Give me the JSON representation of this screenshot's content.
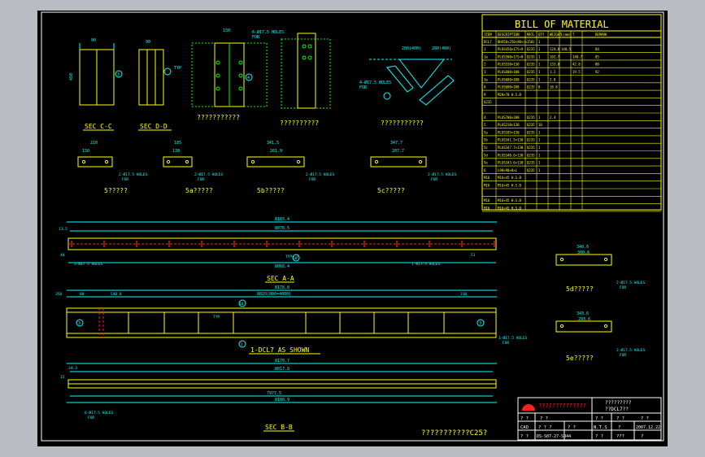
{
  "views": {
    "sec_cc": "SEC C-C",
    "sec_dd": "SEC D-D",
    "view_a": "???????????",
    "view_b": "??????????",
    "view_c": "???????????",
    "typ": "TYP",
    "dims_cc": [
      "90",
      "450"
    ],
    "dims_top": [
      "150",
      "280(400)",
      "280(400)",
      "390"
    ],
    "holes_top": "6-Ø17.5 HOLES",
    "for_top": "FOR",
    "holes_mid": "4-Ø17.5 HOLES",
    "for_mid": "FOR"
  },
  "plates": [
    {
      "label": "5?????",
      "dim_top": "210",
      "dims_in": [
        "80",
        "130",
        "80"
      ],
      "holes": "2-Ø17.5 HOLES",
      "for": "FOR"
    },
    {
      "label": "5a?????",
      "dim_top": "185",
      "dims_in": [
        "130"
      ],
      "holes": "2-Ø17.5 HOLES",
      "for": "FOR"
    },
    {
      "label": "5b?????",
      "dim_top": "341.5",
      "dims_in": [
        "261.9"
      ],
      "holes": "2-Ø17.5 HOLES",
      "for": "FOR"
    },
    {
      "label": "5c?????",
      "dim_top": "347.7",
      "dims_in": [
        "207.7"
      ],
      "holes": "2-Ø17.5 HOLES",
      "for": "FOR"
    },
    {
      "label": "5d?????",
      "dim_top": "340.6",
      "dims_in": [
        "300.6"
      ],
      "holes": "2-Ø17.5 HOLES",
      "for": "FOR"
    },
    {
      "label": "5e?????",
      "dim_top": "343.6",
      "dims_in": [
        "293.6"
      ],
      "holes": "2-Ø17.5 HOLES",
      "for": "FOR"
    }
  ],
  "sec_aa": {
    "title": "SEC A-A",
    "overall": "8183.4",
    "inner": "8078.5",
    "bottom_total": "8068.4",
    "typ": "TYP. 7",
    "left_holes": "3-Ø17.5 HOLES",
    "right_holes": "1-Ø17.5 HOLES",
    "small_dims": [
      "13.5",
      "40",
      "9"
    ],
    "dim_end": "51",
    "mark": "10"
  },
  "dcl7": {
    "title": "1-DCL7 AS SHOWN",
    "overall": "8178.8",
    "chain": "8810(800=4000)",
    "dims_left": [
      "350",
      "88",
      "540.8"
    ],
    "dim_right": "310",
    "holes": "1-Ø17.5 HOLES",
    "for": "FOR",
    "typ": "TYP",
    "marks": [
      "3",
      "1",
      "10"
    ]
  },
  "sec_bb": {
    "title": "SEC B-B",
    "overall": "8170.7",
    "inner": "8017.8",
    "bottom1": "7977.5",
    "bottom2": "8180.9",
    "holes": "6-Ø17.5 HOLES",
    "for": "FOR",
    "small_dims": [
      "34.3",
      "15"
    ],
    "mark": "10"
  },
  "bom": {
    "title": "BILL OF MATERIAL",
    "headers": [
      "ITEM",
      "DESCRIPTION",
      "MATL",
      "QTY",
      "WEIGHT",
      "L(mm)",
      "T",
      "REMARK"
    ],
    "rows": [
      [
        "DCL7",
        "BH450×250×90×(×150)",
        "",
        "1",
        "",
        "",
        "",
        ""
      ],
      [
        "1",
        "PLUS450×175×9",
        "Q235",
        "1",
        "124.8",
        "148.5",
        "",
        "84"
      ],
      [
        "1a",
        "PLUS500×175×8",
        "Q235",
        "1",
        "102.7",
        "",
        "148.7",
        "85"
      ],
      [
        "2",
        "PLUS530×130",
        "Q235",
        "1",
        "133.8",
        "",
        "42.8",
        "88"
      ],
      [
        "3",
        "PLUS600×100",
        "Q235",
        "1",
        "1.2",
        "",
        "19.5",
        "92"
      ],
      [
        "3a",
        "PLUS600×100",
        "Q235",
        "1",
        "2.8",
        "",
        "",
        ""
      ],
      [
        "8",
        "PLUS600×100",
        "Q235",
        "8",
        "18.8",
        "",
        "",
        ""
      ],
      [
        "9",
        "M20×70 H.S.B",
        "",
        "",
        "",
        "",
        "",
        ""
      ],
      [
        "Q235",
        "",
        "",
        "",
        "",
        "",
        "",
        ""
      ],
      [
        "",
        "",
        "",
        "",
        "",
        "",
        "",
        ""
      ],
      [
        "4",
        "PLUS700×200",
        "Q235",
        "1",
        "2.4",
        "",
        "",
        ""
      ],
      [
        "5",
        "PLUS210×130",
        "Q235",
        "10",
        "",
        "",
        "",
        ""
      ],
      [
        "5a",
        "PLUS185×130",
        "Q235",
        "1",
        "",
        "",
        "",
        ""
      ],
      [
        "5b",
        "PLUS341.5×130",
        "Q235",
        "1",
        "",
        "",
        "",
        ""
      ],
      [
        "5c",
        "PLUS347.7×130",
        "Q235",
        "1",
        "",
        "",
        "",
        ""
      ],
      [
        "5d",
        "PLUS340.6×130",
        "Q235",
        "1",
        "",
        "",
        "",
        ""
      ],
      [
        "5e",
        "PLUS343.6×130",
        "Q235",
        "1",
        "",
        "",
        "",
        ""
      ],
      [
        "6",
        "L90×90×8×L",
        "Q235",
        "1",
        "",
        "",
        "",
        ""
      ],
      [
        "M16",
        "M16×45 H.S.B",
        "",
        "",
        "",
        "",
        "",
        ""
      ],
      [
        "M16",
        "M16×45 H.S.B",
        "",
        "",
        "",
        "",
        "",
        ""
      ],
      [
        "",
        "",
        "",
        "",
        "",
        "",
        "",
        ""
      ],
      [
        "M16",
        "M16×45 H.S.B",
        "",
        "",
        "",
        "",
        "",
        ""
      ],
      [
        "M16",
        "M16×45 H.S.B",
        "",
        "",
        "",
        "",
        "",
        ""
      ]
    ]
  },
  "title_block": {
    "company": "??????????????",
    "project_name": "?????????",
    "drawing_name": "??DCL7??",
    "labels": [
      "?  ?",
      "CAD",
      "?  ?"
    ],
    "values_r1": [
      "?  ?",
      "?  ?",
      "?  ?",
      "?  ?"
    ],
    "values_r2": [
      "?  ?  ?",
      "?  ?",
      "N.T.S",
      "?",
      "2007.12.22"
    ],
    "values_r3": [
      "DS-S07-27-SO44",
      "?  ?",
      "???",
      "?"
    ],
    "logo_color": "#ff2020"
  },
  "footer_title": "???????????C25?",
  "colors": {
    "cyan": "#00ffff",
    "yellow": "#ffff00",
    "green": "#00ff00",
    "red": "#ff2020",
    "white": "#ffffff",
    "grey": "#b9bcc3",
    "black": "#000000"
  }
}
